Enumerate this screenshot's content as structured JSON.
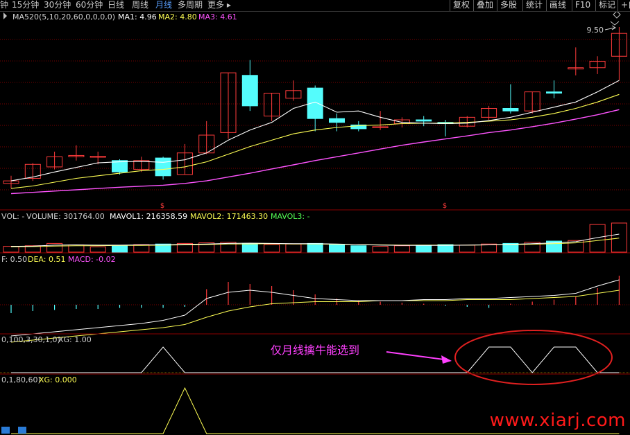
{
  "toolbar": {
    "periods": [
      "钟",
      "15分钟",
      "30分钟",
      "60分钟",
      "日线",
      "周线",
      "月线",
      "多周期",
      "更多 ▸"
    ],
    "active_period": "月线",
    "tools": [
      "复权",
      "叠加",
      "多股",
      "统计",
      "画线",
      "F10",
      "标记",
      "+自"
    ]
  },
  "colors": {
    "up": "#ff3b3b",
    "down": "#54fcfc",
    "ma1": "#ffffff",
    "ma2": "#ffff54",
    "ma3": "#ff54ff",
    "grid": "#7a0000",
    "separator": "#8b0000",
    "annotation": "#ff40ff",
    "ellipse": "#e02020",
    "logo": "#ff1a1a"
  },
  "price_panel": {
    "legend_name": "MA520(5,10,20,60,0,0,0,0)",
    "ma1_label": "MA1: 4.96",
    "ma2_label": "MA2: 4.80",
    "ma3_label": "MA3: 4.61",
    "high_label": "9.50",
    "marker": "$",
    "ylim": [
      2.8,
      9.8
    ]
  },
  "volume_panel": {
    "vol_label": "VOL: -",
    "volume_label": "VOLUME: 301764.00",
    "mavol1_label": "MAVOL1: 216358.59",
    "mavol2_label": "MAVOL2: 171463.30",
    "mavol3_label": "MAVOL3: -"
  },
  "macd_panel": {
    "dif_label": "F: 0.50",
    "dea_label": "DEA: 0.51",
    "macd_label": "MACD: -0.02"
  },
  "xg1_panel": {
    "params_label": "0,100,3,30,1,0)",
    "xg_label": "XG: 1.00",
    "annotation": "仅月线擒牛能选到"
  },
  "xg2_panel": {
    "params_label": "0,1,80,60)",
    "xg_label": "XG: 0.000"
  },
  "watermark": "www.xiarj.com",
  "chart_data": {
    "type": "candlestick",
    "candles": [
      {
        "o": 3.35,
        "c": 3.45,
        "h": 3.65,
        "l": 3.15
      },
      {
        "o": 3.55,
        "c": 4.1,
        "h": 4.15,
        "l": 3.45
      },
      {
        "o": 4.0,
        "c": 4.4,
        "h": 4.6,
        "l": 3.9
      },
      {
        "o": 4.4,
        "c": 4.45,
        "h": 4.85,
        "l": 4.25
      },
      {
        "o": 4.4,
        "c": 4.42,
        "h": 4.6,
        "l": 4.1
      },
      {
        "o": 4.25,
        "c": 3.8,
        "h": 4.3,
        "l": 3.7
      },
      {
        "o": 3.9,
        "c": 4.25,
        "h": 4.4,
        "l": 3.8
      },
      {
        "o": 4.35,
        "c": 3.65,
        "h": 4.4,
        "l": 3.5
      },
      {
        "o": 3.7,
        "c": 4.55,
        "h": 4.9,
        "l": 3.7
      },
      {
        "o": 4.55,
        "c": 5.25,
        "h": 5.8,
        "l": 4.5
      },
      {
        "o": 5.35,
        "c": 7.7,
        "h": 7.7,
        "l": 5.1
      },
      {
        "o": 7.6,
        "c": 6.4,
        "h": 8.2,
        "l": 6.2
      },
      {
        "o": 6.0,
        "c": 6.9,
        "h": 6.9,
        "l": 5.8
      },
      {
        "o": 6.7,
        "c": 7.0,
        "h": 7.4,
        "l": 6.6
      },
      {
        "o": 7.1,
        "c": 5.9,
        "h": 7.2,
        "l": 5.4
      },
      {
        "o": 5.9,
        "c": 5.75,
        "h": 6.1,
        "l": 5.4
      },
      {
        "o": 5.65,
        "c": 5.5,
        "h": 5.8,
        "l": 5.4
      },
      {
        "o": 5.55,
        "c": 5.58,
        "h": 6.2,
        "l": 5.45
      },
      {
        "o": 5.7,
        "c": 5.85,
        "h": 5.95,
        "l": 5.55
      },
      {
        "o": 5.85,
        "c": 5.8,
        "h": 6.0,
        "l": 5.6
      },
      {
        "o": 5.75,
        "c": 5.7,
        "h": 5.85,
        "l": 5.2
      },
      {
        "o": 5.6,
        "c": 5.95,
        "h": 6.0,
        "l": 5.55
      },
      {
        "o": 5.95,
        "c": 6.3,
        "h": 6.4,
        "l": 5.85
      },
      {
        "o": 6.3,
        "c": 6.2,
        "h": 7.25,
        "l": 6.1
      },
      {
        "o": 6.2,
        "c": 6.95,
        "h": 6.95,
        "l": 6.1
      },
      {
        "o": 6.95,
        "c": 6.9,
        "h": 7.4,
        "l": 6.7
      },
      {
        "o": 7.85,
        "c": 7.9,
        "h": 8.7,
        "l": 7.6
      },
      {
        "o": 7.9,
        "c": 8.15,
        "h": 8.35,
        "l": 7.65
      },
      {
        "o": 8.35,
        "c": 9.25,
        "h": 9.5,
        "l": 7.4
      }
    ],
    "ma1": [
      3.45,
      3.6,
      3.8,
      3.98,
      4.16,
      4.2,
      4.22,
      4.18,
      4.28,
      4.55,
      5.05,
      5.45,
      5.75,
      6.3,
      6.55,
      6.15,
      6.2,
      5.95,
      5.75,
      5.72,
      5.7,
      5.72,
      5.82,
      5.95,
      6.15,
      6.35,
      6.55,
      6.95,
      7.4
    ],
    "ma2": [
      3.15,
      3.25,
      3.4,
      3.55,
      3.65,
      3.75,
      3.85,
      3.9,
      4.0,
      4.2,
      4.5,
      4.8,
      5.05,
      5.3,
      5.45,
      5.55,
      5.62,
      5.65,
      5.7,
      5.72,
      5.72,
      5.75,
      5.8,
      5.85,
      5.95,
      6.1,
      6.3,
      6.55,
      6.85
    ],
    "ma3": [
      2.95,
      3.0,
      3.05,
      3.1,
      3.15,
      3.2,
      3.24,
      3.28,
      3.35,
      3.45,
      3.6,
      3.75,
      3.92,
      4.08,
      4.25,
      4.4,
      4.55,
      4.7,
      4.85,
      4.98,
      5.1,
      5.22,
      5.35,
      5.45,
      5.58,
      5.72,
      5.88,
      6.05,
      6.25
    ],
    "volume": [
      20,
      22,
      30,
      25,
      18,
      22,
      26,
      28,
      30,
      32,
      34,
      30,
      26,
      28,
      30,
      26,
      22,
      20,
      22,
      24,
      26,
      24,
      28,
      30,
      34,
      38,
      40,
      95,
      100
    ],
    "mavol1": [
      20,
      21,
      24,
      25,
      24,
      24,
      25,
      25,
      27,
      28,
      30,
      31,
      30,
      29,
      29,
      28,
      26,
      24,
      23,
      23,
      23,
      24,
      25,
      27,
      29,
      32,
      36,
      50,
      62
    ],
    "mavol2": [
      18,
      19,
      21,
      22,
      22,
      23,
      23,
      24,
      25,
      26,
      28,
      28,
      29,
      28,
      28,
      27,
      26,
      25,
      24,
      24,
      24,
      24,
      25,
      26,
      27,
      29,
      32,
      40,
      48
    ],
    "macd_hist": [
      -8,
      -6,
      -5,
      -4,
      -4,
      -3,
      -3,
      -3,
      -2,
      15,
      22,
      20,
      18,
      14,
      10,
      6,
      4,
      3,
      2,
      1,
      -1,
      -2,
      -3,
      1,
      3,
      5,
      8,
      16,
      28
    ],
    "dif": [
      -30,
      -28,
      -26,
      -24,
      -22,
      -20,
      -18,
      -15,
      -10,
      6,
      12,
      14,
      12,
      9,
      6,
      5,
      4,
      4,
      4,
      5,
      5,
      6,
      6,
      7,
      8,
      9,
      11,
      18,
      24
    ],
    "dea": [
      -36,
      -34,
      -32,
      -30,
      -28,
      -26,
      -24,
      -22,
      -19,
      -12,
      -6,
      -2,
      1,
      2,
      3,
      3,
      3,
      4,
      4,
      4,
      4,
      5,
      5,
      5,
      6,
      7,
      8,
      11,
      14
    ],
    "xg1": [
      0,
      0,
      0,
      0,
      0,
      0,
      0,
      1,
      0,
      0,
      0,
      0,
      0,
      0,
      0,
      0,
      0,
      0,
      0,
      0,
      0,
      0,
      1,
      1,
      0,
      1,
      1,
      0,
      0
    ],
    "xg2": [
      0,
      0,
      0,
      0,
      0,
      0,
      0,
      0,
      1,
      0,
      0,
      0,
      0,
      0,
      0,
      0,
      0,
      0,
      0,
      0,
      0,
      0,
      0,
      0,
      0,
      0,
      0,
      0,
      0
    ]
  }
}
